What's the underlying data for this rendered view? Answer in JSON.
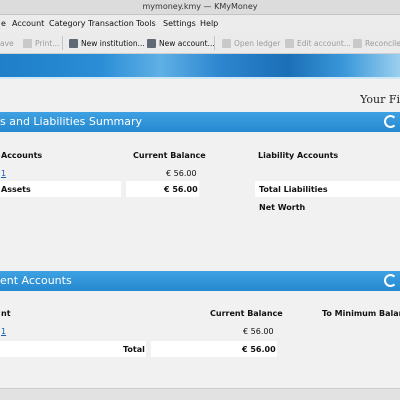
{
  "window": {
    "title": "mymoney.kmy — KMyMoney"
  },
  "menu": [
    "e",
    "Account",
    "Category",
    "Transaction",
    "Tools",
    "Settings",
    "Help"
  ],
  "toolbar": {
    "save": "ave",
    "print": "Print...",
    "new_institution": "New institution...",
    "new_account": "New account...",
    "open_ledger": "Open ledger",
    "edit_account": "Edit account...",
    "reconcile": "Reconcile..."
  },
  "page": {
    "title": "Your Fi"
  },
  "summary": {
    "title": "s and Liabilities Summary",
    "col_accounts": "Accounts",
    "col_balance": "Current Balance",
    "col_liability": "Liability Accounts",
    "row_account": "1",
    "row_balance": "€ 56.00",
    "total_assets_label": "Assets",
    "total_assets_value": "€ 56.00",
    "total_liabilities_label": "Total Liabilities",
    "net_worth_label": "Net Worth"
  },
  "payment": {
    "title": "ent Accounts",
    "col_account": "nt",
    "col_balance": "Current Balance",
    "col_min": "To Minimum Balanc",
    "row_account": "1",
    "row_balance": "€ 56.00",
    "total_label": "Total",
    "total_value": "€ 56.00"
  },
  "colors": {
    "section_header": "#2b8fd6",
    "link": "#1a5fb4"
  }
}
